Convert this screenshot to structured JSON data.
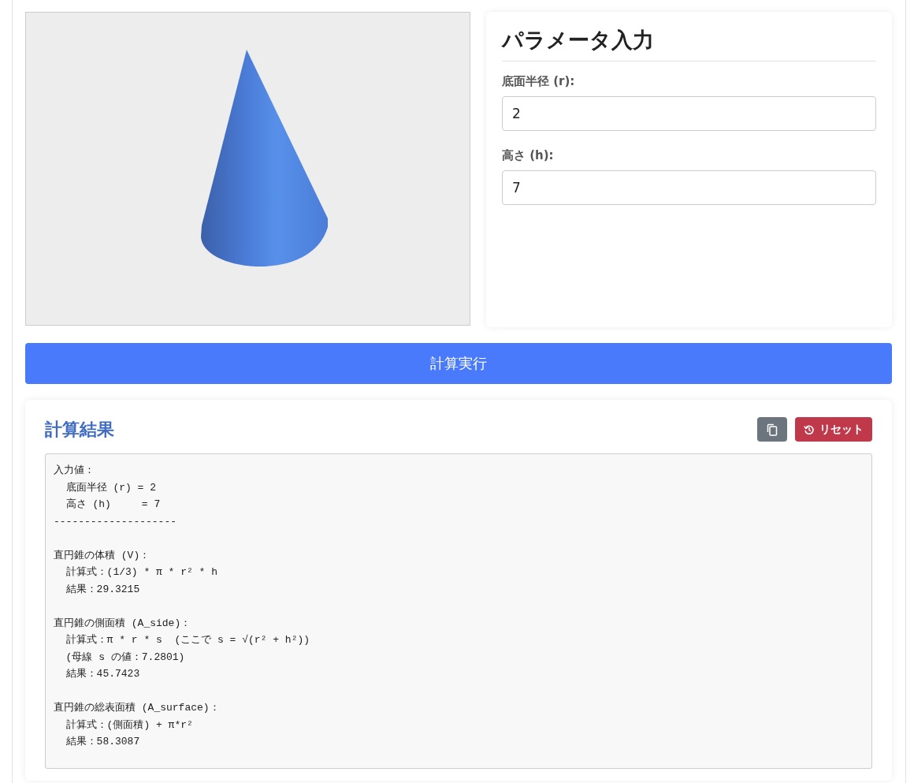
{
  "parameters": {
    "title": "パラメータ入力",
    "fields": [
      {
        "label": "底面半径 (r):",
        "value": "2"
      },
      {
        "label": "高さ (h):",
        "value": "7"
      }
    ]
  },
  "calculate_button": "計算実行",
  "results": {
    "title": "計算結果",
    "reset_button": "リセット",
    "output_blocks": [
      [
        "入力値：",
        "  底面半径 (r) = 2",
        "  高さ (h)     = 7",
        "--------------------"
      ],
      [
        "直円錐の体積 (V)：",
        "  計算式：(1/3) * π * r² * h",
        "  結果：29.3215"
      ],
      [
        "直円錐の側面積 (A_side)：",
        "  計算式：π * r * s  (ここで s = √(r² + h²))",
        "  (母線 s の値：7.2801)",
        "  結果：45.7423"
      ],
      [
        "直円錐の総表面積 (A_surface)：",
        "  計算式：(側面積) + π*r²",
        "  結果：58.3087"
      ]
    ]
  }
}
